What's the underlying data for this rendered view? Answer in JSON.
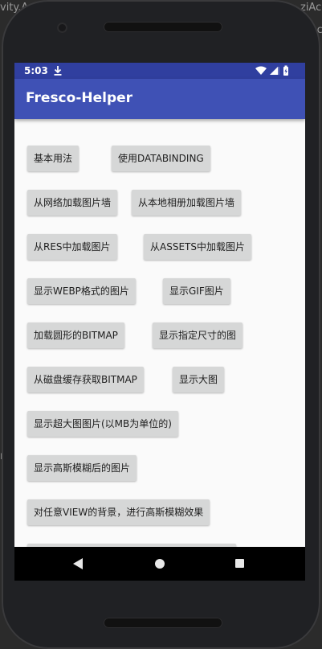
{
  "ide": {
    "fragment_left_top": "vity.A",
    "fragment_right_top": "ziAc",
    "fragment_right_mid": "Ac",
    "fragment_left_mid": "r"
  },
  "status_bar": {
    "time": "5:03",
    "download_icon": "download-icon",
    "wifi_icon": "wifi-icon",
    "signal_icon": "cell-signal-icon",
    "battery_icon": "battery-icon",
    "color": "#303f9f"
  },
  "app_bar": {
    "title": "Fresco-Helper",
    "color": "#3f51b5"
  },
  "buttons": [
    {
      "label": "基本用法"
    },
    {
      "label": "使用DATABINDING"
    },
    {
      "label": "从网络加载图片墙"
    },
    {
      "label": "从本地相册加载图片墙"
    },
    {
      "label": "从RES中加载图片"
    },
    {
      "label": "从ASSETS中加载图片"
    },
    {
      "label": "显示WEBP格式的图片"
    },
    {
      "label": "显示GIF图片"
    },
    {
      "label": "加载圆形的BITMAP"
    },
    {
      "label": "显示指定尺寸的图"
    },
    {
      "label": "从磁盘缓存获取BITMAP"
    },
    {
      "label": "显示大图"
    },
    {
      "label": "显示超大图图片(以MB为单位的)"
    },
    {
      "label": "显示高斯模糊后的图片"
    },
    {
      "label": "对任意VIEW的背景，进行高斯模糊效果"
    }
  ],
  "nav_bar": {
    "back_icon": "back-triangle-icon",
    "home_icon": "home-circle-icon",
    "recents_icon": "recents-square-icon"
  }
}
